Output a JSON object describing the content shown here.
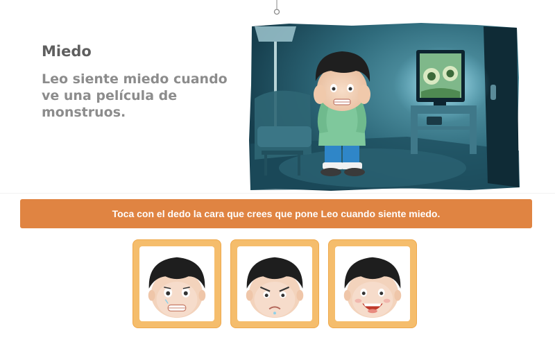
{
  "lesson": {
    "title": "Miedo",
    "description": "Leo siente miedo cuando ve una película de monstruos."
  },
  "instruction": {
    "text": "Toca con el dedo la cara que crees que pone Leo cuando siente miedo."
  },
  "scene": {
    "image_icon": "boy-watching-monster-movie-illustration"
  },
  "choices": [
    {
      "icon": "scared-face-icon",
      "expression": "scared"
    },
    {
      "icon": "angry-face-icon",
      "expression": "angry"
    },
    {
      "icon": "happy-face-icon",
      "expression": "happy"
    }
  ],
  "colors": {
    "banner": "#e08442",
    "card_frame": "#f5bd6c",
    "title_text": "#5f5f5f",
    "description_text": "#8c8c8c"
  }
}
